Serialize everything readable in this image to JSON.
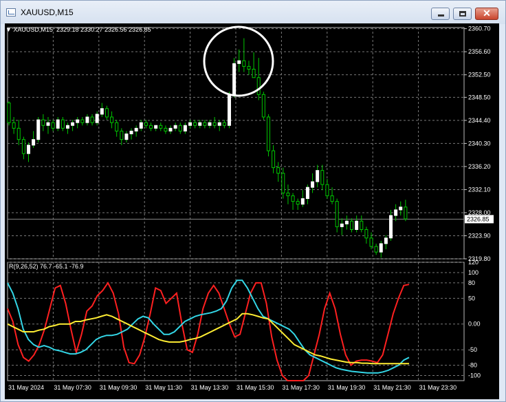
{
  "window": {
    "title": "XAUUSD,M15",
    "icon": "chart-window-icon",
    "controls": {
      "minimize": "minimize-icon",
      "maximize": "maximize-icon",
      "close": "close-icon",
      "close_glyph": "✕"
    }
  },
  "chart": {
    "symbol_label": "XAUUSD,M15",
    "ohlc_text": "2329.18 2330.27 2326.56 2326.85",
    "current_price": "2326.85",
    "background": "#000000",
    "grid_color": "#7a7a7a",
    "bull_color": "#ffffff",
    "wick_color": "#00c800",
    "annotation": "white circle around 31 May 15:00 high"
  },
  "indicator": {
    "label": "R(9,26,52) 76.7 -65.1 -76.9",
    "series_colors": {
      "fast": "#ff2020",
      "mid": "#33d6e6",
      "slow": "#ffee33"
    }
  },
  "chart_data": {
    "type": "candlestick",
    "price_ylim": [
      2319.8,
      2360.9
    ],
    "price_ticks": [
      "2360.70",
      "2356.60",
      "2352.50",
      "2348.50",
      "2344.40",
      "2340.30",
      "2336.20",
      "2332.10",
      "2328.00",
      "2323.90",
      "2319.80"
    ],
    "indicator_ylim": [
      -110,
      120
    ],
    "indicator_ticks": [
      "120",
      "100",
      "80",
      "50",
      "0.00",
      "-50",
      "-80",
      "-100"
    ],
    "time_labels": [
      "31 May 2024",
      "31 May 07:30",
      "31 May 09:30",
      "31 May 11:30",
      "31 May 13:30",
      "31 May 15:30",
      "31 May 17:30",
      "31 May 19:30",
      "31 May 21:30",
      "31 May 23:30"
    ],
    "candles": [
      [
        2347.5,
        2347.8,
        2343.5,
        2344.0
      ],
      [
        2344.0,
        2345.0,
        2342.0,
        2343.0
      ],
      [
        2343.0,
        2344.5,
        2340.0,
        2341.0
      ],
      [
        2341.0,
        2341.5,
        2337.5,
        2338.5
      ],
      [
        2338.5,
        2340.5,
        2337.0,
        2340.0
      ],
      [
        2340.0,
        2342.5,
        2339.5,
        2341.0
      ],
      [
        2341.0,
        2345.0,
        2340.5,
        2344.5
      ],
      [
        2344.5,
        2345.5,
        2342.5,
        2343.5
      ],
      [
        2343.5,
        2345.0,
        2342.0,
        2344.0
      ],
      [
        2344.0,
        2344.5,
        2342.5,
        2343.0
      ],
      [
        2343.0,
        2345.0,
        2342.5,
        2344.5
      ],
      [
        2344.5,
        2345.0,
        2342.5,
        2343.0
      ],
      [
        2343.0,
        2344.0,
        2342.0,
        2343.5
      ],
      [
        2343.5,
        2344.5,
        2342.5,
        2344.0
      ],
      [
        2344.0,
        2345.0,
        2343.0,
        2344.5
      ],
      [
        2344.5,
        2345.0,
        2343.5,
        2344.0
      ],
      [
        2344.0,
        2345.5,
        2343.5,
        2345.0
      ],
      [
        2345.0,
        2345.5,
        2343.5,
        2344.0
      ],
      [
        2344.0,
        2346.0,
        2343.5,
        2345.5
      ],
      [
        2345.5,
        2347.5,
        2345.0,
        2346.5
      ],
      [
        2346.5,
        2347.0,
        2344.5,
        2345.0
      ],
      [
        2345.0,
        2346.0,
        2343.0,
        2344.0
      ],
      [
        2344.0,
        2344.5,
        2341.5,
        2342.5
      ],
      [
        2342.5,
        2343.0,
        2340.0,
        2341.0
      ],
      [
        2341.0,
        2342.5,
        2340.5,
        2342.0
      ],
      [
        2342.0,
        2343.0,
        2341.0,
        2342.5
      ],
      [
        2342.5,
        2343.5,
        2341.5,
        2343.0
      ],
      [
        2343.0,
        2344.5,
        2342.5,
        2344.0
      ],
      [
        2344.0,
        2344.5,
        2343.0,
        2343.5
      ],
      [
        2343.5,
        2344.0,
        2342.5,
        2343.0
      ],
      [
        2343.0,
        2343.5,
        2342.5,
        2343.5
      ],
      [
        2343.5,
        2344.0,
        2342.5,
        2343.0
      ],
      [
        2343.0,
        2343.5,
        2342.0,
        2342.5
      ],
      [
        2342.5,
        2343.5,
        2342.0,
        2343.0
      ],
      [
        2343.0,
        2344.0,
        2342.5,
        2343.5
      ],
      [
        2343.5,
        2344.0,
        2342.0,
        2342.5
      ],
      [
        2342.5,
        2344.0,
        2342.0,
        2343.5
      ],
      [
        2343.5,
        2344.5,
        2343.0,
        2344.0
      ],
      [
        2344.0,
        2344.5,
        2343.0,
        2343.5
      ],
      [
        2343.5,
        2344.5,
        2343.0,
        2344.0
      ],
      [
        2344.0,
        2344.5,
        2343.0,
        2343.5
      ],
      [
        2343.5,
        2344.5,
        2343.0,
        2344.0
      ],
      [
        2344.0,
        2345.0,
        2343.0,
        2343.5
      ],
      [
        2343.5,
        2344.5,
        2342.5,
        2344.0
      ],
      [
        2344.0,
        2344.5,
        2343.0,
        2343.5
      ],
      [
        2343.5,
        2349.5,
        2343.0,
        2349.0
      ],
      [
        2349.0,
        2355.5,
        2348.5,
        2354.5
      ],
      [
        2354.5,
        2357.0,
        2353.0,
        2355.0
      ],
      [
        2355.0,
        2359.0,
        2353.0,
        2354.0
      ],
      [
        2354.0,
        2355.0,
        2352.5,
        2353.5
      ],
      [
        2353.5,
        2356.5,
        2352.5,
        2352.0
      ],
      [
        2352.0,
        2355.5,
        2348.0,
        2349.0
      ],
      [
        2349.0,
        2349.5,
        2344.5,
        2345.0
      ],
      [
        2345.0,
        2345.5,
        2338.0,
        2339.0
      ],
      [
        2339.0,
        2340.0,
        2335.0,
        2336.0
      ],
      [
        2336.0,
        2337.0,
        2333.5,
        2335.0
      ],
      [
        2335.0,
        2336.0,
        2330.5,
        2331.5
      ],
      [
        2331.5,
        2333.0,
        2329.5,
        2331.0
      ],
      [
        2331.0,
        2331.5,
        2328.5,
        2330.0
      ],
      [
        2330.0,
        2330.5,
        2328.5,
        2329.5
      ],
      [
        2329.5,
        2332.0,
        2329.0,
        2330.5
      ],
      [
        2330.5,
        2333.0,
        2329.5,
        2332.5
      ],
      [
        2332.5,
        2335.0,
        2331.5,
        2333.5
      ],
      [
        2333.5,
        2336.5,
        2332.5,
        2335.5
      ],
      [
        2335.5,
        2336.5,
        2332.0,
        2333.0
      ],
      [
        2333.0,
        2334.0,
        2330.5,
        2331.0
      ],
      [
        2331.0,
        2332.5,
        2329.5,
        2330.0
      ],
      [
        2330.0,
        2330.5,
        2324.5,
        2325.5
      ],
      [
        2325.5,
        2327.0,
        2324.0,
        2326.0
      ],
      [
        2326.0,
        2327.5,
        2325.0,
        2326.5
      ],
      [
        2326.5,
        2327.0,
        2324.5,
        2325.0
      ],
      [
        2325.0,
        2327.5,
        2324.5,
        2326.5
      ],
      [
        2326.5,
        2327.5,
        2324.5,
        2325.0
      ],
      [
        2325.0,
        2325.5,
        2322.5,
        2323.5
      ],
      [
        2323.5,
        2324.5,
        2321.5,
        2322.0
      ],
      [
        2322.0,
        2322.5,
        2320.5,
        2321.0
      ],
      [
        2321.0,
        2323.0,
        2320.0,
        2322.5
      ],
      [
        2322.5,
        2324.0,
        2321.5,
        2323.5
      ],
      [
        2323.5,
        2328.5,
        2323.0,
        2327.5
      ],
      [
        2327.5,
        2329.5,
        2326.5,
        2328.5
      ],
      [
        2328.5,
        2330.0,
        2327.5,
        2329.0
      ],
      [
        2329.0,
        2330.3,
        2326.5,
        2326.9
      ]
    ],
    "series": [
      {
        "name": "",
        "color": "#ff2020",
        "values": [
          30,
          5,
          -40,
          -65,
          -72,
          -60,
          -40,
          -10,
          30,
          70,
          75,
          40,
          -10,
          -55,
          -20,
          25,
          35,
          55,
          65,
          80,
          60,
          20,
          -45,
          -75,
          -77,
          -60,
          -25,
          20,
          70,
          65,
          40,
          50,
          60,
          0,
          -50,
          -55,
          -20,
          30,
          60,
          75,
          60,
          30,
          0,
          -25,
          -20,
          20,
          60,
          80,
          80,
          40,
          -25,
          -70,
          -100,
          -110,
          -110,
          -110,
          -110,
          -100,
          -60,
          -20,
          30,
          60,
          30,
          -20,
          -60,
          -80,
          -72,
          -70,
          -70,
          -72,
          -75,
          -60,
          -20,
          20,
          50,
          75,
          77
        ]
      },
      {
        "name": "",
        "color": "#33d6e6",
        "values": [
          80,
          60,
          30,
          -10,
          -30,
          -40,
          -45,
          -42,
          -45,
          -50,
          -52,
          -55,
          -58,
          -58,
          -55,
          -50,
          -40,
          -30,
          -25,
          -22,
          -22,
          -20,
          -15,
          -10,
          0,
          10,
          15,
          12,
          0,
          -10,
          -20,
          -20,
          -15,
          -5,
          5,
          10,
          15,
          18,
          20,
          22,
          25,
          30,
          45,
          70,
          85,
          85,
          70,
          50,
          30,
          15,
          10,
          5,
          0,
          -5,
          -10,
          -20,
          -35,
          -50,
          -60,
          -65,
          -70,
          -75,
          -80,
          -85,
          -88,
          -90,
          -92,
          -93,
          -94,
          -95,
          -95,
          -95,
          -93,
          -90,
          -85,
          -80,
          -70,
          -65
        ]
      },
      {
        "name": "",
        "color": "#ffee33",
        "values": [
          0,
          -5,
          -10,
          -15,
          -15,
          -15,
          -12,
          -10,
          -5,
          -3,
          0,
          0,
          0,
          5,
          5,
          8,
          10,
          12,
          15,
          18,
          15,
          10,
          5,
          0,
          -5,
          -10,
          -15,
          -20,
          -25,
          -30,
          -33,
          -35,
          -35,
          -35,
          -33,
          -30,
          -28,
          -25,
          -20,
          -15,
          -10,
          -5,
          0,
          5,
          10,
          20,
          20,
          18,
          15,
          12,
          10,
          0,
          -10,
          -20,
          -30,
          -40,
          -45,
          -50,
          -55,
          -60,
          -62,
          -65,
          -68,
          -70,
          -72,
          -74,
          -75,
          -75,
          -76,
          -76,
          -77,
          -77,
          -77,
          -77,
          -77,
          -77,
          -77,
          -77
        ]
      }
    ]
  }
}
